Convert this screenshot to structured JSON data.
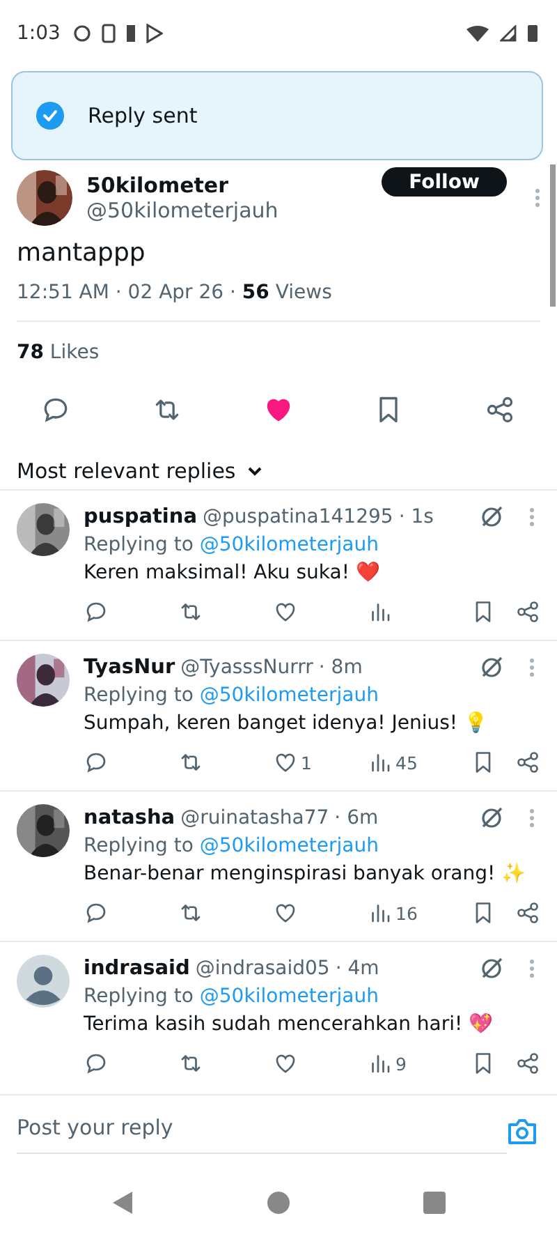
{
  "status_bar": {
    "time": "1:03"
  },
  "toast": {
    "message": "Reply sent"
  },
  "post": {
    "author": {
      "name": "50kilometer",
      "handle": "@50kilometerjauh"
    },
    "follow_label": "Follow",
    "text": "mantappp",
    "meta": "12:51 AM · 02 Apr 26 · ",
    "views_count": "56",
    "views_label": " Views",
    "likes_count": "78",
    "likes_label": " Likes",
    "liked": true
  },
  "replies_filter": {
    "label": "Most relevant replies"
  },
  "replies": [
    {
      "name": "puspatina",
      "handle": "@puspatina141295",
      "time": "· 1s",
      "replying_to_label": "Replying to",
      "replying_to": "@50kilometerjauh",
      "text": "Keren maksimal! Aku suka! ❤️",
      "liked": false
    },
    {
      "name": "TyasNur",
      "handle": "@TyasssNurrr",
      "time": "· 8m",
      "replying_to_label": "Replying to",
      "replying_to": "@50kilometerjauh",
      "text": "Sumpah, keren banget idenya! Jenius! 💡",
      "liked": false,
      "likes": "1",
      "views": "45"
    },
    {
      "name": "natasha",
      "handle": "@ruinatasha77",
      "time": "· 6m",
      "replying_to_label": "Replying to",
      "replying_to": "@50kilometerjauh",
      "text": "Benar-benar menginspirasi banyak orang! ✨",
      "liked": false,
      "views": "16"
    },
    {
      "name": "indrasaid",
      "handle": "@indrasaid05",
      "time": "· 4m",
      "replying_to_label": "Replying to",
      "replying_to": "@50kilometerjauh",
      "text": "Terima kasih sudah mencerahkan hari! 💖",
      "avatar": {
        "kind": "default"
      },
      "liked": false,
      "views": "9"
    }
  ],
  "composer": {
    "placeholder": "Post your reply"
  }
}
